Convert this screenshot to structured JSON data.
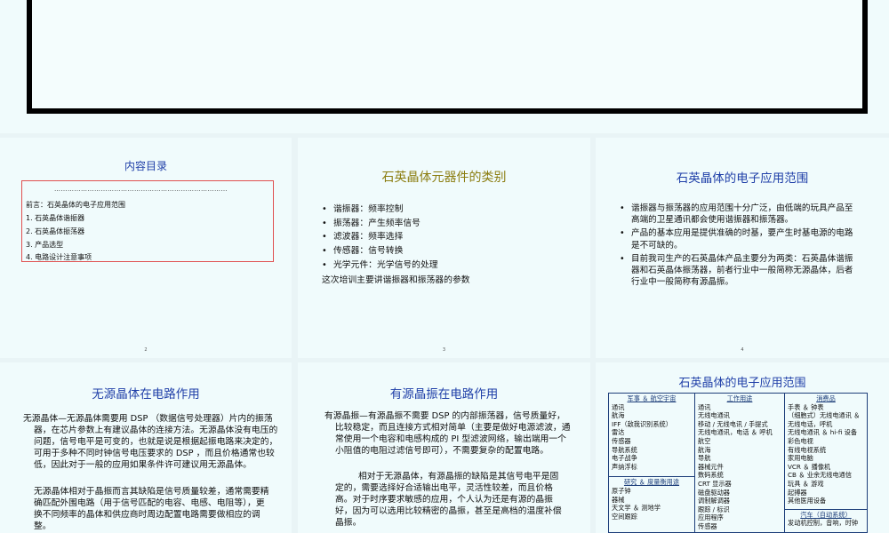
{
  "toc": {
    "title": "内容目录",
    "dots": "……………………………………………………………………",
    "items": [
      "前言：石英晶体的电子应用范围",
      "1.    石英晶体谐振器",
      "2.    石英晶体振荡器",
      "3.    产品选型",
      "4.    电路设计注意事项"
    ],
    "page": "2"
  },
  "types": {
    "title": "石英晶体元器件的类别",
    "items": [
      "谐振器：频率控制",
      "振荡器：产生频率信号",
      "滤波器：频率选择",
      "传感器：信号转换",
      "光学元件：光学信号的处理"
    ],
    "note": "这次培训主要讲谐振器和振荡器的参数",
    "page": "3"
  },
  "scope": {
    "title": "石英晶体的电子应用范围",
    "items": [
      "谐振器与振荡器的应用范围十分广泛，由低端的玩具产品至高端的卫星通讯都会使用谐振器和振荡器。",
      "产品的基本应用是提供准确的时基，要产生时基电源的电路是不可缺的。",
      "目前我司生产的石英晶体产品主要分为两类：石英晶体谐振器和石英晶体振荡器，前者行业中一般简称无源晶体，后者行业中一般简称有源晶振。"
    ],
    "page": "4"
  },
  "passive": {
    "title": "无源晶体在电路作用",
    "p1": "无源晶体—无源晶体需要用 DSP （数据信号处理器）片内的振荡器，在芯片参数上有建议晶体的连接方法。无源晶体没有电压的问题，信号电平是可变的，也就是说是根据起振电路来决定的，可用于多种不同时钟信号电压要求的 DSP ，而且价格通常也较低，因此对于一般的应用如果条件许可建议用无源晶体。",
    "p2": "无源晶体相对于晶振而言其缺陷是信号质量较差，通常需要精确匹配外围电路（用于信号匹配的电容、电感、电阻等），更换不同频率的晶体和供应商时周边配置电路需要做相应的调整。"
  },
  "active": {
    "title": "有源晶振在电路作用",
    "p1": "有源晶振—有源晶振不需要 DSP 的内部振荡器，信号质量好，比较稳定，而且连接方式相对简单（主要是做好电源滤波，通常使用一个电容和电感构成的 PI 型滤波网络，输出端用一个小阻值的电阻过滤信号即可），不需要复杂的配置电路。",
    "p2": "相对于无源晶体，有源晶振的缺陷是其信号电平是固定的，需要选择好合适输出电平，灵活性较差，而且价格高。对于时序要求敏感的应用，个人认为还是有源的晶振好，因为可以选用比较精密的晶振，甚至是高档的温度补偿晶振。"
  },
  "apps": {
    "title": "石英晶体的电子应用范围",
    "col1_head": "军事 ＆ 航空宇宙",
    "col1": [
      "通讯",
      "航海",
      "IFF（敌我识别系统）",
      "雷达",
      "传感器",
      "导航系统",
      "电子战争",
      "声纳浮标"
    ],
    "col1b_head": "研究 ＆ 度量衡用途",
    "col1b": [
      "原子钟",
      "器械",
      "天文学 ＆ 测地学",
      "空间跟踪"
    ],
    "col2_head": "工作用途",
    "col2": [
      "通讯",
      "无线电通讯",
      "移动 / 无线电讯 / 手提式",
      "无线电通讯，电话 ＆ 呼机",
      "航空",
      "航海",
      "导航",
      "器械元件",
      "数码系统",
      "CRT 显示器",
      "磁盘驱动器",
      "调制解调器",
      "跟踪 / 标识",
      "应用程序",
      "传感器"
    ],
    "col3_head": "消费品",
    "col3": [
      "手表 ＆ 钟表",
      "（细胞式）无线电通讯 ＆",
      "无线电话，呼机",
      "无线电通讯 ＆ hi-fi 设备",
      "彩色电视",
      "有线电视系统",
      "家用电脑",
      "VCR ＆ 播像机",
      "CB ＆ 业余无线电通信",
      "玩具 ＆ 游戏",
      "起搏器",
      "其他医用设备"
    ],
    "col3b_head": "汽车（自动系统）",
    "col3b": [
      "发动机控制，音响，时钟"
    ]
  }
}
